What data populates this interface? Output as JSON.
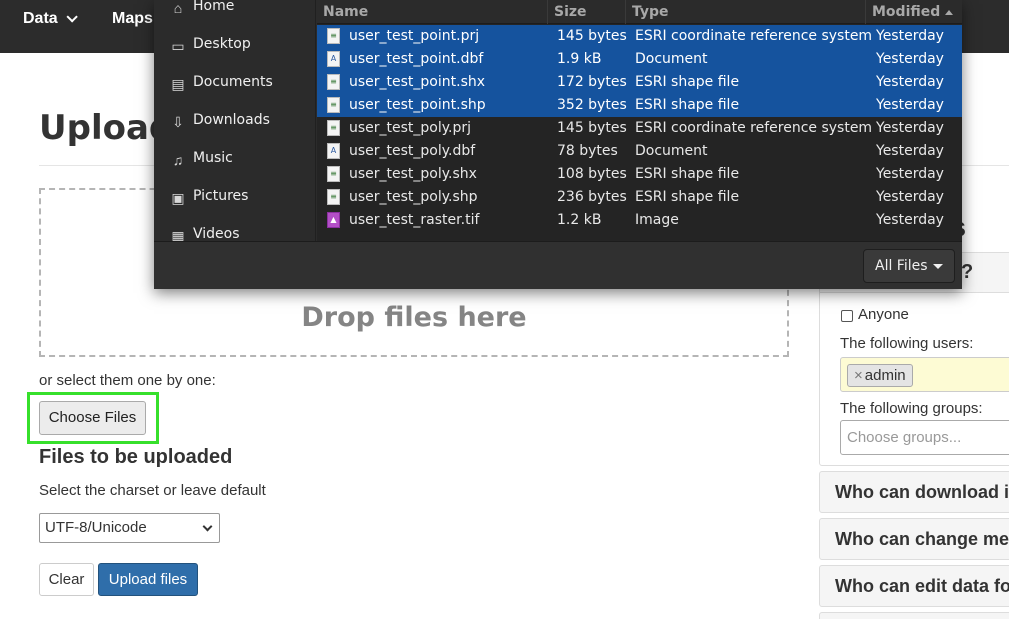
{
  "nav": {
    "data_label": "Data",
    "maps_label": "Maps"
  },
  "page": {
    "title": "Upload",
    "drop_text": "Drop files here",
    "select_text": "or select them one by one:",
    "choose_files": "Choose Files",
    "files_title": "Files to be uploaded",
    "charset_label": "Select the charset or leave default",
    "charset_value": "UTF-8/Unicode",
    "clear": "Clear",
    "upload": "Upload files"
  },
  "permissions": {
    "heading_tail": "s",
    "panel_head_tail": "?",
    "anyone": "Anyone",
    "users_label": "The following users:",
    "user_tag": "admin",
    "tag_remove": "×",
    "groups_label": "The following groups:",
    "groups_placeholder": "Choose groups...",
    "accordions": [
      "Who can download it?",
      "Who can change meta",
      "Who can edit data for",
      ""
    ]
  },
  "dialog": {
    "sidebar": [
      {
        "label": "Home",
        "icon": "home-icon"
      },
      {
        "label": "Desktop",
        "icon": "desktop-icon"
      },
      {
        "label": "Documents",
        "icon": "documents-icon"
      },
      {
        "label": "Downloads",
        "icon": "downloads-icon"
      },
      {
        "label": "Music",
        "icon": "music-icon"
      },
      {
        "label": "Pictures",
        "icon": "pictures-icon"
      },
      {
        "label": "Videos",
        "icon": "videos-icon"
      }
    ],
    "columns": {
      "name": "Name",
      "size": "Size",
      "type": "Type",
      "modified": "Modified"
    },
    "files": [
      {
        "name": "user_test_point.prj",
        "size": "145 bytes",
        "type": "ESRI coordinate reference system",
        "modified": "Yesterday",
        "icon": "text-file-icon",
        "selected": true
      },
      {
        "name": "user_test_point.dbf",
        "size": "1.9 kB",
        "type": "Document",
        "modified": "Yesterday",
        "icon": "document-file-icon",
        "selected": true
      },
      {
        "name": "user_test_point.shx",
        "size": "172 bytes",
        "type": "ESRI shape file",
        "modified": "Yesterday",
        "icon": "text-file-icon",
        "selected": true
      },
      {
        "name": "user_test_point.shp",
        "size": "352 bytes",
        "type": "ESRI shape file",
        "modified": "Yesterday",
        "icon": "text-file-icon",
        "selected": true
      },
      {
        "name": "user_test_poly.prj",
        "size": "145 bytes",
        "type": "ESRI coordinate reference system",
        "modified": "Yesterday",
        "icon": "text-file-icon",
        "selected": false
      },
      {
        "name": "user_test_poly.dbf",
        "size": "78 bytes",
        "type": "Document",
        "modified": "Yesterday",
        "icon": "document-file-icon",
        "selected": false
      },
      {
        "name": "user_test_poly.shx",
        "size": "108 bytes",
        "type": "ESRI shape file",
        "modified": "Yesterday",
        "icon": "text-file-icon",
        "selected": false
      },
      {
        "name": "user_test_poly.shp",
        "size": "236 bytes",
        "type": "ESRI shape file",
        "modified": "Yesterday",
        "icon": "text-file-icon",
        "selected": false
      },
      {
        "name": "user_test_raster.tif",
        "size": "1.2 kB",
        "type": "Image",
        "modified": "Yesterday",
        "icon": "image-file-icon",
        "selected": false
      }
    ],
    "filter": "All Files"
  },
  "colors": {
    "navbar": "#2c2c2c",
    "selection": "#15539e",
    "highlight": "#36e02b",
    "upload_button": "#2f6eaa"
  }
}
